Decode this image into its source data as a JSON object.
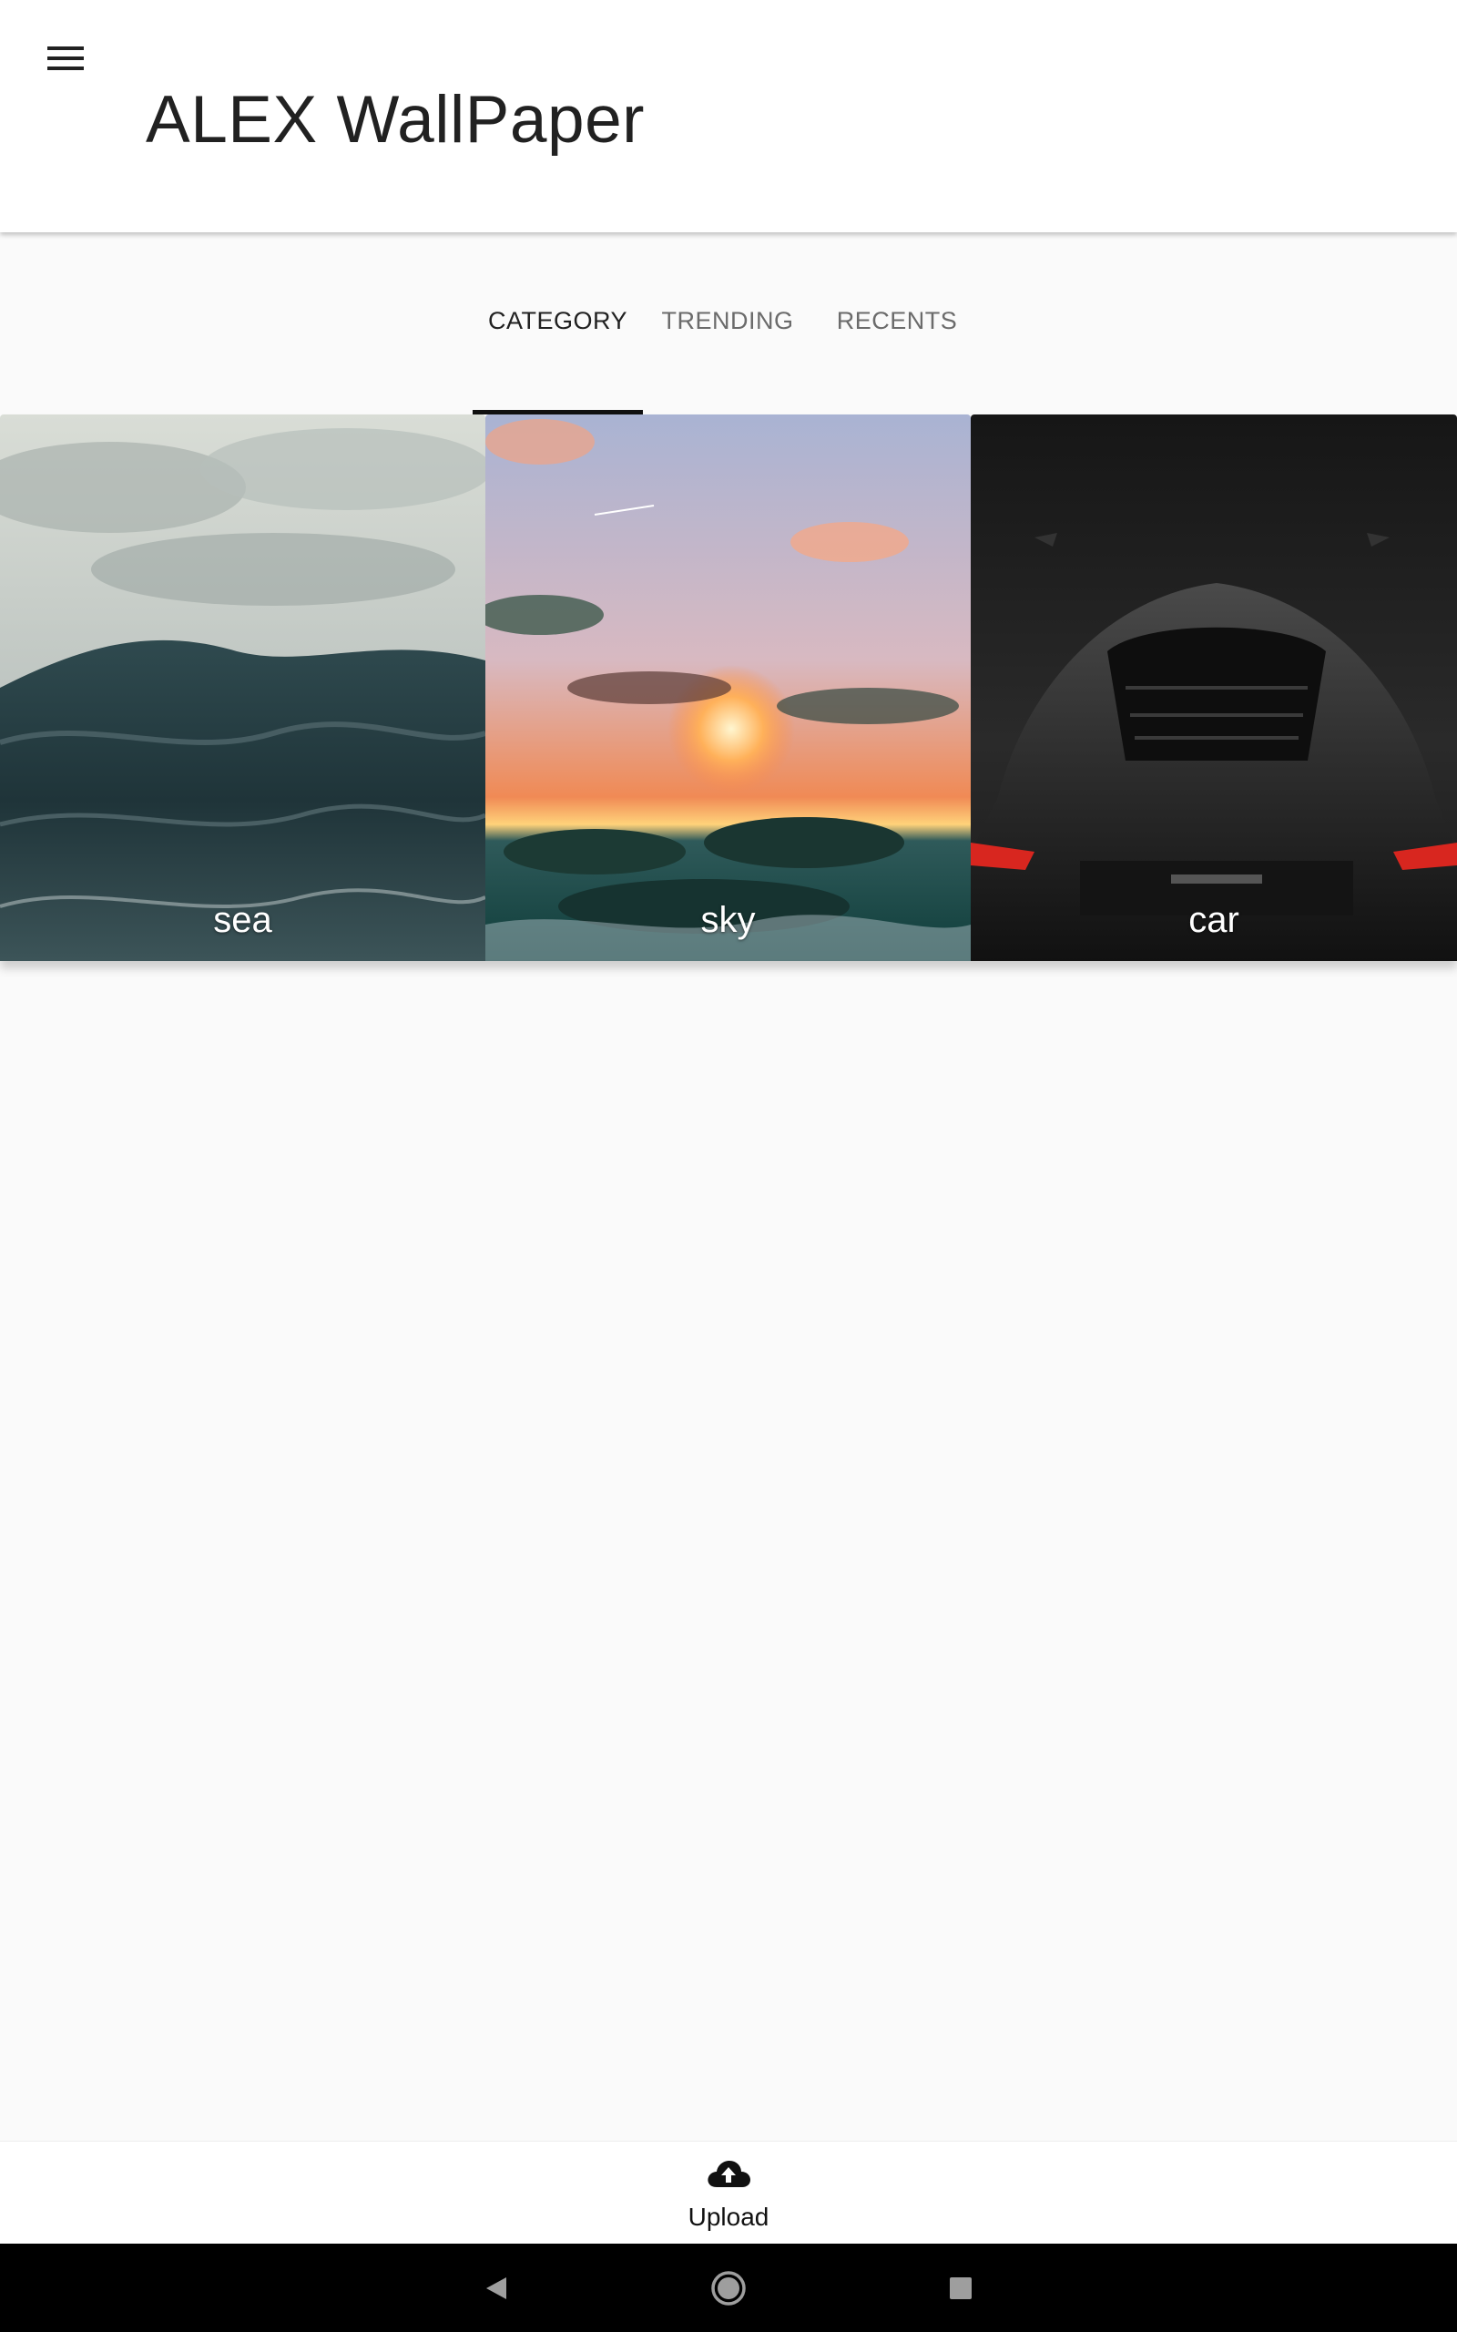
{
  "app": {
    "title": "ALEX WallPaper"
  },
  "icons": {
    "menu": "hamburger-menu-icon",
    "upload": "cloud-upload-icon",
    "back": "back-triangle-icon",
    "home": "home-circle-icon",
    "recents": "recents-square-icon"
  },
  "tabs": [
    {
      "label": "CATEGORY",
      "active": true
    },
    {
      "label": "TRENDING",
      "active": false
    },
    {
      "label": "RECENTS",
      "active": false
    }
  ],
  "categories": [
    {
      "label": "sea"
    },
    {
      "label": "sky"
    },
    {
      "label": "car"
    }
  ],
  "bottom_nav": {
    "upload_label": "Upload"
  },
  "colors": {
    "appbar": "#ffffff",
    "background": "#fafafa",
    "active_tab": "#212121",
    "inactive_tab": "#6b6b6b",
    "indicator": "#111111",
    "system_nav": "#000000"
  }
}
